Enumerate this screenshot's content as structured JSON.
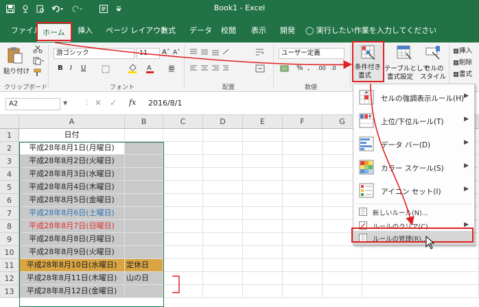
{
  "window": {
    "title": "Book1 - Excel"
  },
  "tabs": {
    "file": "ファイル",
    "home": "ホーム",
    "insert": "挿入",
    "page_layout": "ページ レイアウト",
    "formulas": "数式",
    "data": "データ",
    "review": "校閲",
    "view": "表示",
    "developer": "開発",
    "tell_me": "実行したい作業を入力してください"
  },
  "ribbon": {
    "clipboard": {
      "paste": "貼り付け",
      "label": "クリップボード"
    },
    "font": {
      "name": "游ゴシック",
      "size": "11",
      "label": "フォント",
      "bold": "B",
      "italic": "I",
      "underline": "U"
    },
    "alignment": {
      "label": "配置"
    },
    "number": {
      "format": "ユーザー定義",
      "label": "数値"
    },
    "styles": {
      "conditional_line1": "条件付き",
      "conditional_line2": "書式",
      "table_line1": "テーブルとして",
      "table_line2": "書式設定",
      "cell_line1": "セルの",
      "cell_line2": "スタイル"
    },
    "cells": {
      "insert": "挿入",
      "delete": "削除",
      "format": "書式"
    }
  },
  "formula_bar": {
    "name_box": "A2",
    "fx": "fx",
    "value": "2016/8/1"
  },
  "grid": {
    "columns": [
      "A",
      "B",
      "C",
      "D",
      "E",
      "F",
      "G"
    ],
    "rows": [
      {
        "num": "1",
        "a": "日付",
        "b": ""
      },
      {
        "num": "2",
        "a": "平成28年8月1日(月曜日)",
        "b": ""
      },
      {
        "num": "3",
        "a": "平成28年8月2日(火曜日)",
        "b": ""
      },
      {
        "num": "4",
        "a": "平成28年8月3日(水曜日)",
        "b": ""
      },
      {
        "num": "5",
        "a": "平成28年8月4日(木曜日)",
        "b": ""
      },
      {
        "num": "6",
        "a": "平成28年8月5日(金曜日)",
        "b": ""
      },
      {
        "num": "7",
        "a": "平成28年8月6日(土曜日)",
        "b": ""
      },
      {
        "num": "8",
        "a": "平成28年8月7日(日曜日)",
        "b": ""
      },
      {
        "num": "9",
        "a": "平成28年8月8日(月曜日)",
        "b": ""
      },
      {
        "num": "10",
        "a": "平成28年8月9日(火曜日)",
        "b": ""
      },
      {
        "num": "11",
        "a": "平成28年8月10日(水曜日)",
        "b": "定休日"
      },
      {
        "num": "12",
        "a": "平成28年8月11日(木曜日)",
        "b": "山の日"
      },
      {
        "num": "13",
        "a": "平成28年8月12日(金曜日)",
        "b": ""
      }
    ]
  },
  "menu": {
    "highlight": "セルの強調表示ルール(H)",
    "topbottom": "上位/下位ルール(T)",
    "databar": "データ バー(D)",
    "colorscale": "カラー スケール(S)",
    "iconset": "アイコン セット(I)",
    "new_rule": "新しいルール(N)...",
    "clear_rules": "ルールのクリア(C)",
    "manage_rules": "ルールの管理(R)..."
  },
  "colors": {
    "excel_green": "#217346",
    "annotation_red": "#e02020",
    "saturday_blue": "#2e75b6",
    "sunday_red": "#e03030",
    "holiday_fill": "#d9a441",
    "selection_gray": "#c9c9c9"
  }
}
